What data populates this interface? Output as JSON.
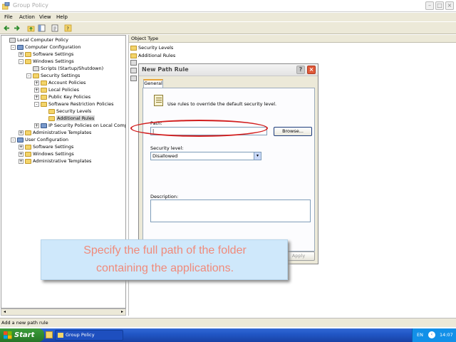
{
  "window": {
    "title": "Group Policy"
  },
  "menubar": [
    "File",
    "Action",
    "View",
    "Help"
  ],
  "tree": [
    {
      "label": "Local Computer Policy",
      "level": 0,
      "exp": "",
      "icon": "doc"
    },
    {
      "label": "Computer Configuration",
      "level": 1,
      "exp": "-",
      "icon": "comp"
    },
    {
      "label": "Software Settings",
      "level": 2,
      "exp": "+",
      "icon": "fold"
    },
    {
      "label": "Windows Settings",
      "level": 2,
      "exp": "-",
      "icon": "fold"
    },
    {
      "label": "Scripts (Startup/Shutdown)",
      "level": 3,
      "exp": "",
      "icon": "doc"
    },
    {
      "label": "Security Settings",
      "level": 3,
      "exp": "-",
      "icon": "fold"
    },
    {
      "label": "Account Policies",
      "level": 4,
      "exp": "+",
      "icon": "fold"
    },
    {
      "label": "Local Policies",
      "level": 4,
      "exp": "+",
      "icon": "fold"
    },
    {
      "label": "Public Key Policies",
      "level": 4,
      "exp": "+",
      "icon": "fold"
    },
    {
      "label": "Software Restriction Policies",
      "level": 4,
      "exp": "-",
      "icon": "fold"
    },
    {
      "label": "Security Levels",
      "level": 5,
      "exp": "",
      "icon": "fold"
    },
    {
      "label": "Additional Rules",
      "level": 5,
      "exp": "",
      "icon": "fold",
      "selected": true
    },
    {
      "label": "IP Security Policies on Local Computer",
      "level": 4,
      "exp": "+",
      "icon": "comp"
    },
    {
      "label": "Administrative Templates",
      "level": 2,
      "exp": "+",
      "icon": "fold"
    },
    {
      "label": "User Configuration",
      "level": 1,
      "exp": "-",
      "icon": "comp"
    },
    {
      "label": "Software Settings",
      "level": 2,
      "exp": "+",
      "icon": "fold"
    },
    {
      "label": "Windows Settings",
      "level": 2,
      "exp": "+",
      "icon": "fold"
    },
    {
      "label": "Administrative Templates",
      "level": 2,
      "exp": "+",
      "icon": "fold"
    }
  ],
  "rightpane": {
    "column_header": "Object Type",
    "items": [
      {
        "label": "Security Levels",
        "icon": "fold"
      },
      {
        "label": "Additional Rules",
        "icon": "fold"
      }
    ]
  },
  "dialog": {
    "title": "New Path Rule",
    "help_label": "?",
    "close_label": "×",
    "tab_label": "General",
    "intro": "Use rules to override the default security level.",
    "path_label": "Path:",
    "path_value": "|",
    "browse_label": "Browse...",
    "security_level_label": "Security level:",
    "security_level_value": "Disallowed",
    "description_label": "Description:",
    "apply_label": "Apply"
  },
  "callout": {
    "line1": "Specify the full path of the folder",
    "line2": "containing the applications."
  },
  "statusbar": {
    "text": "Add a new path rule"
  },
  "taskbar": {
    "start_label": "Start",
    "task_label": "Group Policy",
    "language": "EN",
    "clock": "14:07"
  }
}
